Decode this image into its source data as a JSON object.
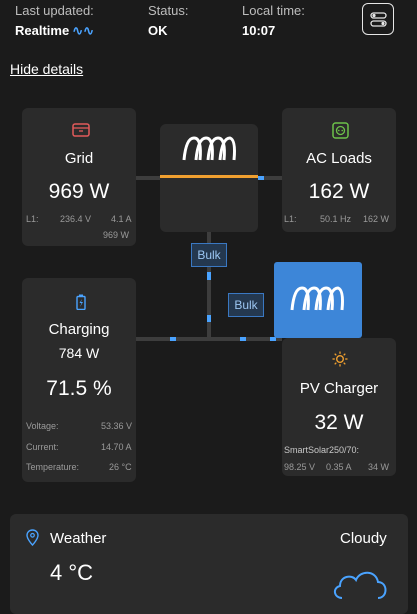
{
  "header": {
    "last_updated_label": "Last updated:",
    "last_updated_value": "Realtime",
    "status_label": "Status:",
    "status_value": "OK",
    "local_time_label": "Local time:",
    "local_time_value": "10:07"
  },
  "hide_details": "Hide details",
  "grid": {
    "title": "Grid",
    "power": "969 W",
    "l1_label": "L1:",
    "voltage": "236.4 V",
    "current": "4.1 A",
    "power_small": "969 W"
  },
  "ac_loads": {
    "title": "AC Loads",
    "power": "162 W",
    "l1_label": "L1:",
    "freq": "50.1 Hz",
    "power_small": "162 W"
  },
  "state_label_1": "Bulk",
  "state_label_2": "Bulk",
  "battery": {
    "title": "Charging",
    "power": "784 W",
    "soc": "71.5 %",
    "voltage_label": "Voltage:",
    "voltage": "53.36 V",
    "current_label": "Current:",
    "current": "14.70 A",
    "temp_label": "Temperature:",
    "temp": "26 °C"
  },
  "pv": {
    "title": "PV Charger",
    "power": "32 W",
    "device": "SmartSolar250/70:",
    "voltage": "98.25 V",
    "current": "0.35 A",
    "power_small": "34 W"
  },
  "weather": {
    "title": "Weather",
    "condition": "Cloudy",
    "temp": "4 °C"
  },
  "colors": {
    "accent": "#4aa3ff",
    "inverter_blue": "#3d86d8",
    "grid_icon": "#e15b5b",
    "acloads_icon": "#6cc24a",
    "sun_icon": "#f0a030",
    "orange_flow": "#f0a030"
  }
}
